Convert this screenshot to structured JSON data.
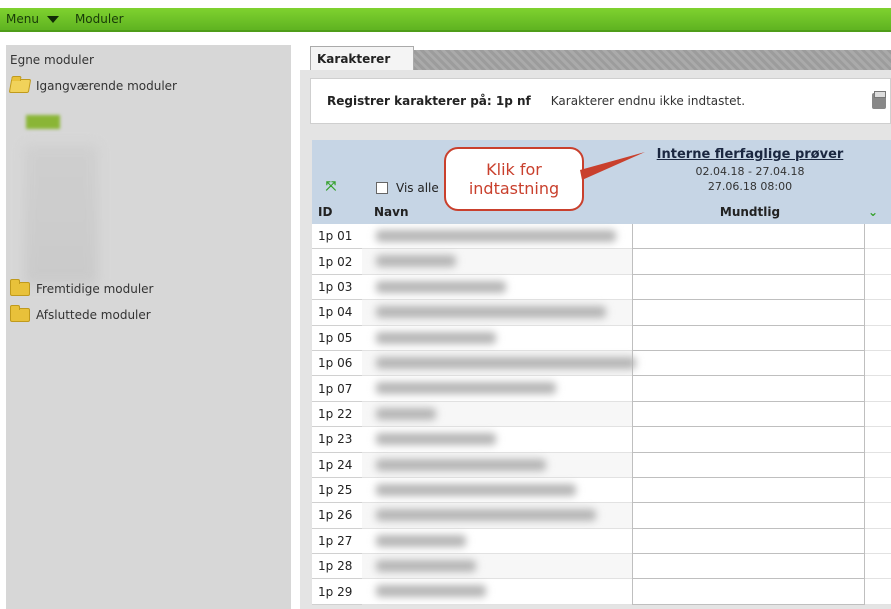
{
  "topbar": {
    "menu_label": "Menu",
    "moduler_label": "Moduler"
  },
  "sidebar": {
    "title": "Egne moduler",
    "folders": [
      {
        "label": "Igangværende moduler"
      },
      {
        "label": "Fremtidige moduler"
      },
      {
        "label": "Afsluttede moduler"
      }
    ]
  },
  "tab": {
    "label": "Karakterer"
  },
  "info": {
    "register_label": "Registrer karakterer på: 1p nf",
    "status": "Karakterer endnu ikke indtastet."
  },
  "table": {
    "show_all_label": "Vis alle",
    "col_id": "ID",
    "col_name": "Navn",
    "exam": {
      "title": "Interne flerfaglige prøver",
      "dates": "02.04.18 - 27.04.18",
      "deadline": "27.06.18 08:00",
      "sub": "Mundtlig"
    },
    "rows": [
      {
        "id": "1p 01"
      },
      {
        "id": "1p 02"
      },
      {
        "id": "1p 03"
      },
      {
        "id": "1p 04"
      },
      {
        "id": "1p 05"
      },
      {
        "id": "1p 06"
      },
      {
        "id": "1p 07"
      },
      {
        "id": "1p 22"
      },
      {
        "id": "1p 23"
      },
      {
        "id": "1p 24"
      },
      {
        "id": "1p 25"
      },
      {
        "id": "1p 26"
      },
      {
        "id": "1p 27"
      },
      {
        "id": "1p 28"
      },
      {
        "id": "1p 29"
      }
    ]
  },
  "callout": {
    "line1": "Klik for",
    "line2": "indtastning"
  },
  "colors": {
    "menu_green": "#6cc227",
    "sidebar_bg": "#d7d7d7",
    "header_blue": "#c6d5e5",
    "callout_red": "#c9402d"
  }
}
